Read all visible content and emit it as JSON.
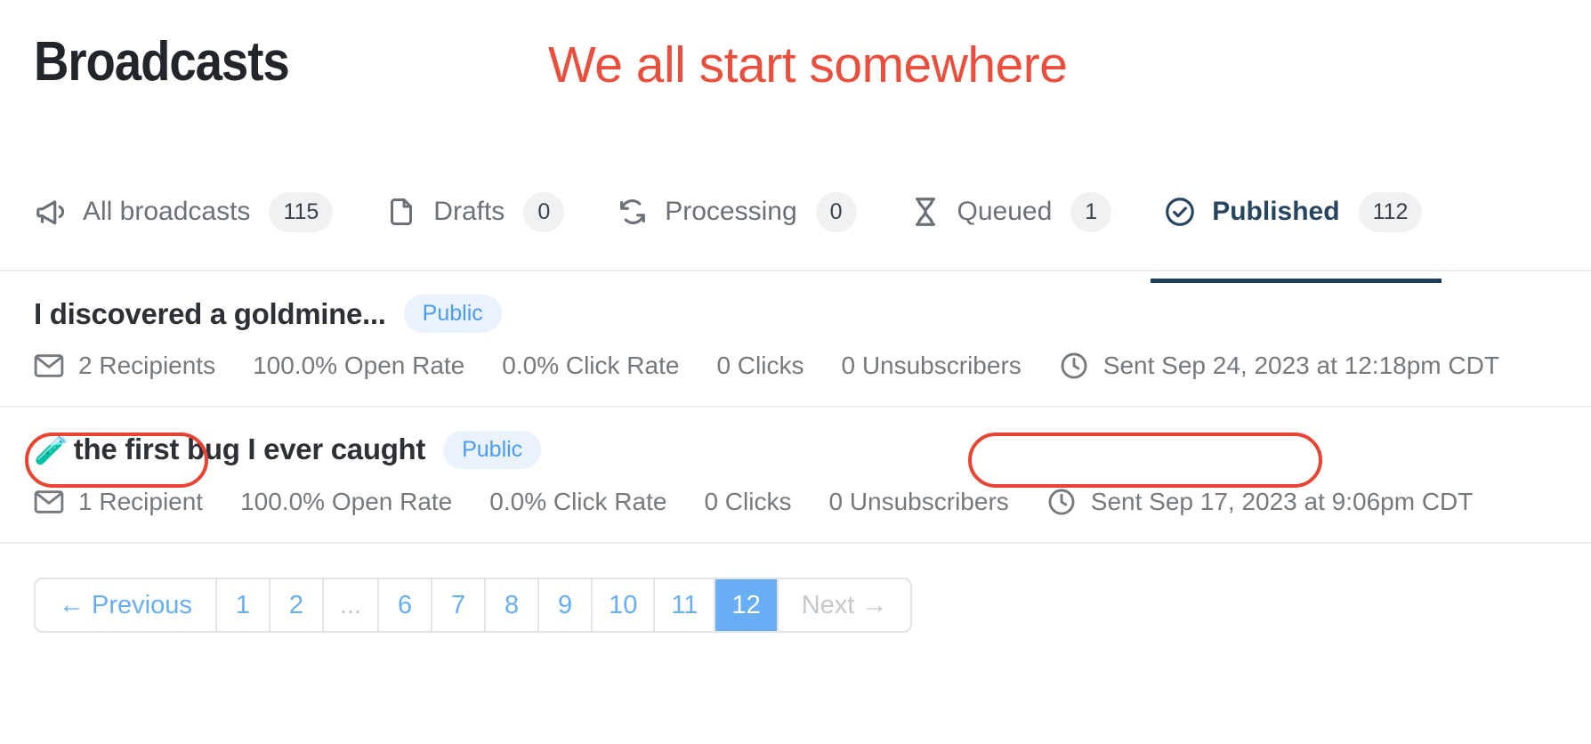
{
  "header": {
    "title": "Broadcasts",
    "headline": "We all start somewhere",
    "headline_color": "#ea4f3d"
  },
  "tabs": [
    {
      "icon": "megaphone-icon",
      "label": "All broadcasts",
      "badge": "115",
      "active": false
    },
    {
      "icon": "document-icon",
      "label": "Drafts",
      "badge": "0",
      "active": false
    },
    {
      "icon": "refresh-icon",
      "label": "Processing",
      "badge": "0",
      "active": false
    },
    {
      "icon": "hourglass-icon",
      "label": "Queued",
      "badge": "1",
      "active": false
    },
    {
      "icon": "check-circle-icon",
      "label": "Published",
      "badge": "112",
      "active": true
    }
  ],
  "broadcasts": [
    {
      "emoji": "",
      "title": "I discovered a goldmine...",
      "visibility": "Public",
      "recipients": "2 Recipients",
      "open_rate": "100.0% Open Rate",
      "click_rate": "0.0% Click Rate",
      "clicks": "0 Clicks",
      "unsubscribers": "0 Unsubscribers",
      "sent": "Sent Sep 24, 2023 at 12:18pm CDT"
    },
    {
      "emoji": "🧪",
      "title": "the first bug I ever caught",
      "visibility": "Public",
      "recipients": "1 Recipient",
      "open_rate": "100.0% Open Rate",
      "click_rate": "0.0% Click Rate",
      "clicks": "0 Clicks",
      "unsubscribers": "0 Unsubscribers",
      "sent": "Sent Sep 17, 2023 at 9:06pm CDT"
    }
  ],
  "annotations": {
    "color": "#ea4332",
    "targets": [
      "1 Recipient",
      "Sent Sep 17, 2023 at 9:06pm CDT"
    ]
  },
  "pagination": {
    "previous_label": "← Previous",
    "next_label": "Next →",
    "gap_label": "...",
    "pages": [
      "1",
      "2",
      "...",
      "6",
      "7",
      "8",
      "9",
      "10",
      "11",
      "12"
    ],
    "current_page": "12",
    "active_color": "#68aef5",
    "link_color": "#67aef5"
  }
}
